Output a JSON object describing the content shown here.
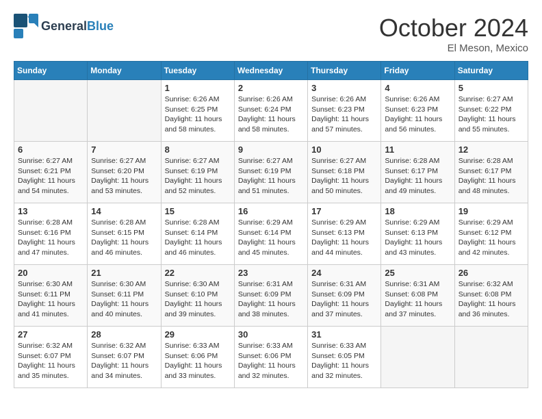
{
  "logo": {
    "general": "General",
    "blue": "Blue"
  },
  "header": {
    "month": "October 2024",
    "location": "El Meson, Mexico"
  },
  "weekdays": [
    "Sunday",
    "Monday",
    "Tuesday",
    "Wednesday",
    "Thursday",
    "Friday",
    "Saturday"
  ],
  "weeks": [
    [
      {
        "day": "",
        "sunrise": "",
        "sunset": "",
        "daylight": ""
      },
      {
        "day": "",
        "sunrise": "",
        "sunset": "",
        "daylight": ""
      },
      {
        "day": "1",
        "sunrise": "Sunrise: 6:26 AM",
        "sunset": "Sunset: 6:25 PM",
        "daylight": "Daylight: 11 hours and 58 minutes."
      },
      {
        "day": "2",
        "sunrise": "Sunrise: 6:26 AM",
        "sunset": "Sunset: 6:24 PM",
        "daylight": "Daylight: 11 hours and 58 minutes."
      },
      {
        "day": "3",
        "sunrise": "Sunrise: 6:26 AM",
        "sunset": "Sunset: 6:23 PM",
        "daylight": "Daylight: 11 hours and 57 minutes."
      },
      {
        "day": "4",
        "sunrise": "Sunrise: 6:26 AM",
        "sunset": "Sunset: 6:23 PM",
        "daylight": "Daylight: 11 hours and 56 minutes."
      },
      {
        "day": "5",
        "sunrise": "Sunrise: 6:27 AM",
        "sunset": "Sunset: 6:22 PM",
        "daylight": "Daylight: 11 hours and 55 minutes."
      }
    ],
    [
      {
        "day": "6",
        "sunrise": "Sunrise: 6:27 AM",
        "sunset": "Sunset: 6:21 PM",
        "daylight": "Daylight: 11 hours and 54 minutes."
      },
      {
        "day": "7",
        "sunrise": "Sunrise: 6:27 AM",
        "sunset": "Sunset: 6:20 PM",
        "daylight": "Daylight: 11 hours and 53 minutes."
      },
      {
        "day": "8",
        "sunrise": "Sunrise: 6:27 AM",
        "sunset": "Sunset: 6:19 PM",
        "daylight": "Daylight: 11 hours and 52 minutes."
      },
      {
        "day": "9",
        "sunrise": "Sunrise: 6:27 AM",
        "sunset": "Sunset: 6:19 PM",
        "daylight": "Daylight: 11 hours and 51 minutes."
      },
      {
        "day": "10",
        "sunrise": "Sunrise: 6:27 AM",
        "sunset": "Sunset: 6:18 PM",
        "daylight": "Daylight: 11 hours and 50 minutes."
      },
      {
        "day": "11",
        "sunrise": "Sunrise: 6:28 AM",
        "sunset": "Sunset: 6:17 PM",
        "daylight": "Daylight: 11 hours and 49 minutes."
      },
      {
        "day": "12",
        "sunrise": "Sunrise: 6:28 AM",
        "sunset": "Sunset: 6:17 PM",
        "daylight": "Daylight: 11 hours and 48 minutes."
      }
    ],
    [
      {
        "day": "13",
        "sunrise": "Sunrise: 6:28 AM",
        "sunset": "Sunset: 6:16 PM",
        "daylight": "Daylight: 11 hours and 47 minutes."
      },
      {
        "day": "14",
        "sunrise": "Sunrise: 6:28 AM",
        "sunset": "Sunset: 6:15 PM",
        "daylight": "Daylight: 11 hours and 46 minutes."
      },
      {
        "day": "15",
        "sunrise": "Sunrise: 6:28 AM",
        "sunset": "Sunset: 6:14 PM",
        "daylight": "Daylight: 11 hours and 46 minutes."
      },
      {
        "day": "16",
        "sunrise": "Sunrise: 6:29 AM",
        "sunset": "Sunset: 6:14 PM",
        "daylight": "Daylight: 11 hours and 45 minutes."
      },
      {
        "day": "17",
        "sunrise": "Sunrise: 6:29 AM",
        "sunset": "Sunset: 6:13 PM",
        "daylight": "Daylight: 11 hours and 44 minutes."
      },
      {
        "day": "18",
        "sunrise": "Sunrise: 6:29 AM",
        "sunset": "Sunset: 6:13 PM",
        "daylight": "Daylight: 11 hours and 43 minutes."
      },
      {
        "day": "19",
        "sunrise": "Sunrise: 6:29 AM",
        "sunset": "Sunset: 6:12 PM",
        "daylight": "Daylight: 11 hours and 42 minutes."
      }
    ],
    [
      {
        "day": "20",
        "sunrise": "Sunrise: 6:30 AM",
        "sunset": "Sunset: 6:11 PM",
        "daylight": "Daylight: 11 hours and 41 minutes."
      },
      {
        "day": "21",
        "sunrise": "Sunrise: 6:30 AM",
        "sunset": "Sunset: 6:11 PM",
        "daylight": "Daylight: 11 hours and 40 minutes."
      },
      {
        "day": "22",
        "sunrise": "Sunrise: 6:30 AM",
        "sunset": "Sunset: 6:10 PM",
        "daylight": "Daylight: 11 hours and 39 minutes."
      },
      {
        "day": "23",
        "sunrise": "Sunrise: 6:31 AM",
        "sunset": "Sunset: 6:09 PM",
        "daylight": "Daylight: 11 hours and 38 minutes."
      },
      {
        "day": "24",
        "sunrise": "Sunrise: 6:31 AM",
        "sunset": "Sunset: 6:09 PM",
        "daylight": "Daylight: 11 hours and 37 minutes."
      },
      {
        "day": "25",
        "sunrise": "Sunrise: 6:31 AM",
        "sunset": "Sunset: 6:08 PM",
        "daylight": "Daylight: 11 hours and 37 minutes."
      },
      {
        "day": "26",
        "sunrise": "Sunrise: 6:32 AM",
        "sunset": "Sunset: 6:08 PM",
        "daylight": "Daylight: 11 hours and 36 minutes."
      }
    ],
    [
      {
        "day": "27",
        "sunrise": "Sunrise: 6:32 AM",
        "sunset": "Sunset: 6:07 PM",
        "daylight": "Daylight: 11 hours and 35 minutes."
      },
      {
        "day": "28",
        "sunrise": "Sunrise: 6:32 AM",
        "sunset": "Sunset: 6:07 PM",
        "daylight": "Daylight: 11 hours and 34 minutes."
      },
      {
        "day": "29",
        "sunrise": "Sunrise: 6:33 AM",
        "sunset": "Sunset: 6:06 PM",
        "daylight": "Daylight: 11 hours and 33 minutes."
      },
      {
        "day": "30",
        "sunrise": "Sunrise: 6:33 AM",
        "sunset": "Sunset: 6:06 PM",
        "daylight": "Daylight: 11 hours and 32 minutes."
      },
      {
        "day": "31",
        "sunrise": "Sunrise: 6:33 AM",
        "sunset": "Sunset: 6:05 PM",
        "daylight": "Daylight: 11 hours and 32 minutes."
      },
      {
        "day": "",
        "sunrise": "",
        "sunset": "",
        "daylight": ""
      },
      {
        "day": "",
        "sunrise": "",
        "sunset": "",
        "daylight": ""
      }
    ]
  ]
}
